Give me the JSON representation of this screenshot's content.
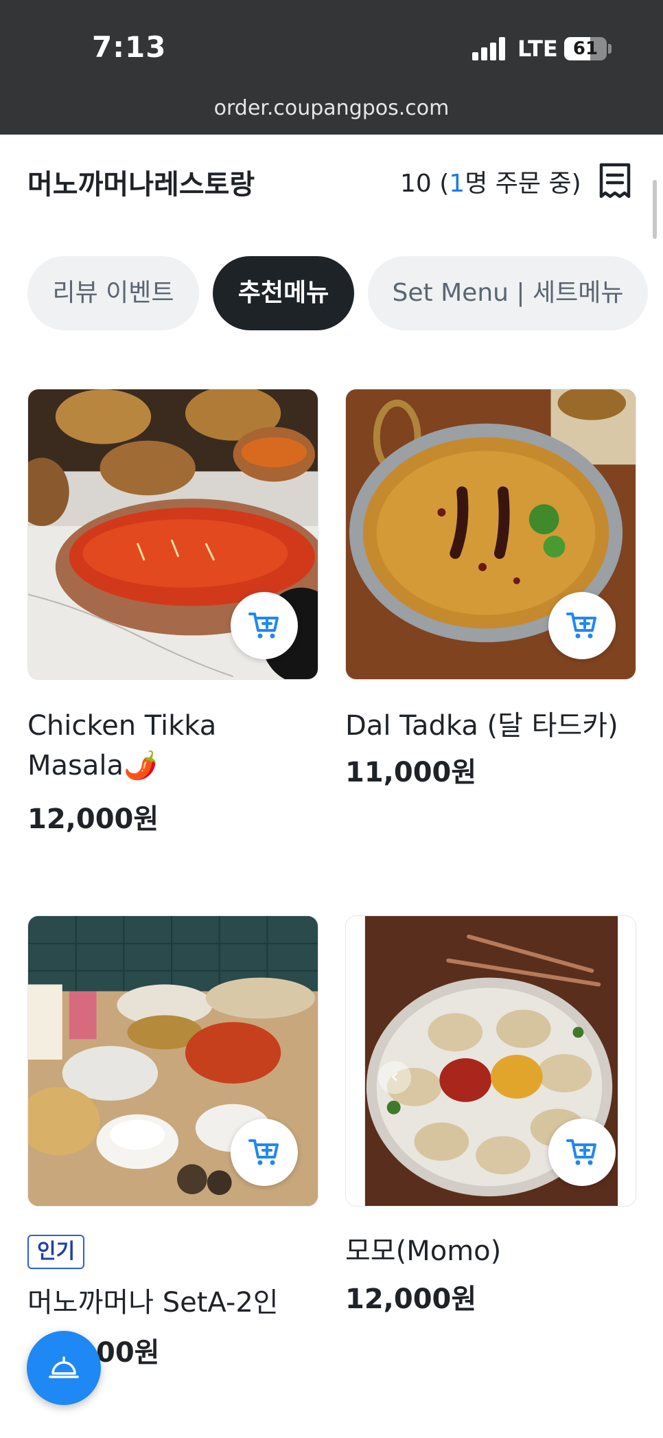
{
  "status_bar": {
    "time": "7:13",
    "network": "LTE",
    "battery": "61",
    "battery_level": 0.61
  },
  "browser": {
    "url": "order.coupangpos.com"
  },
  "header": {
    "restaurant_name": "머노까머나레스토랑",
    "table_number": "10 (",
    "ordering_count": "1",
    "ordering_suffix": "명 주문 중)"
  },
  "tabs": [
    {
      "label": "리뷰 이벤트",
      "active": false
    },
    {
      "label": "추천메뉴",
      "active": true
    },
    {
      "label": "Set Menu | 세트메뉴",
      "active": false
    }
  ],
  "menu_items": [
    {
      "name": "Chicken Tikka Masala🌶️",
      "price": "12,000원",
      "badge": ""
    },
    {
      "name": "Dal Tadka (달 타드카)",
      "price": "11,000원",
      "badge": ""
    },
    {
      "name": "머노까머나 SetA-2인",
      "price": "00원",
      "badge": "인기"
    },
    {
      "name": "모모(Momo)",
      "price": "12,000원",
      "badge": ""
    }
  ],
  "colors": {
    "accent": "#1e88f5",
    "active_tab": "#1e2328",
    "inactive_tab": "#eff1f3",
    "highlight_text": "#1a7be8",
    "status_bar": "#333537"
  },
  "icons": {
    "receipt": "receipt-icon",
    "cart": "cart-plus-icon",
    "fab": "service-bell-icon",
    "carousel_prev": "chevron-left-icon"
  }
}
